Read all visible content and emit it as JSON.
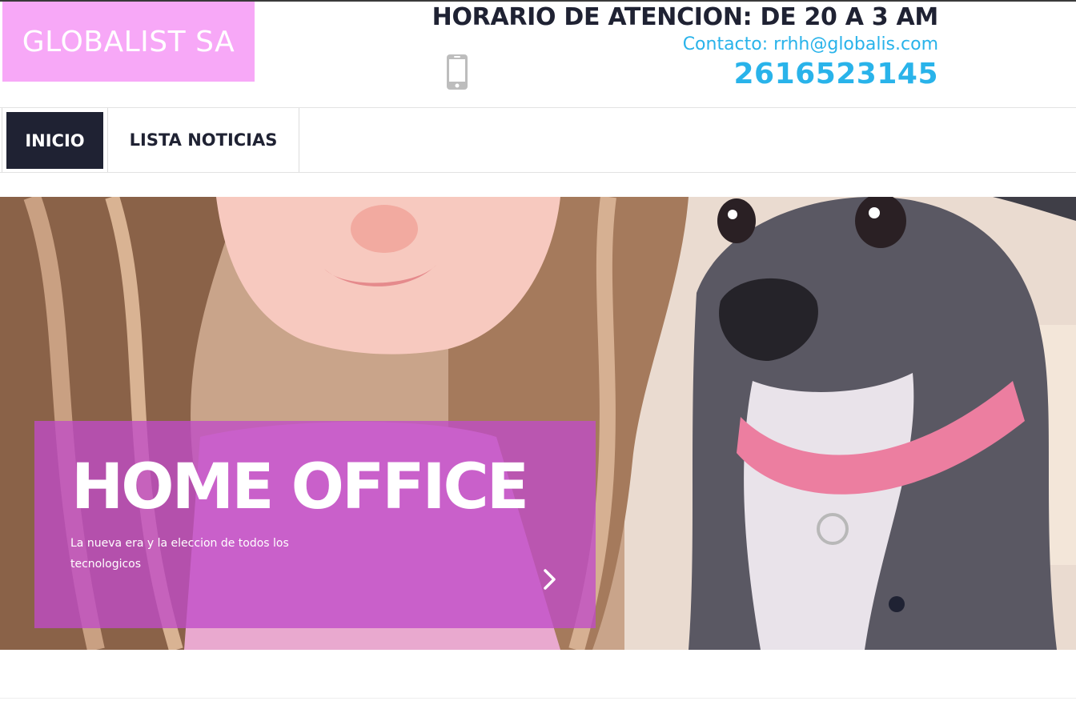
{
  "brand": {
    "name": "GLOBALIST SA",
    "bg_color": "#f7a8f7"
  },
  "header": {
    "hours": "HORARIO DE ATENCION: DE 20 A 3 AM",
    "contact": "Contacto: rrhh@globalis.com",
    "phone": "2616523145",
    "phone_icon": "mobile-phone-icon",
    "accent_color": "#29b3ea",
    "dark_color": "#1f2233"
  },
  "nav": {
    "items": [
      {
        "label": "INICIO",
        "active": true
      },
      {
        "label": "LISTA NOTICIAS",
        "active": false
      }
    ]
  },
  "hero": {
    "title": "HOME OFFICE",
    "text": "La nueva era y la eleccion de todos los tecnologicos",
    "next_icon": "chevron-right-icon",
    "overlay_color": "#c04cc8",
    "slides": 1,
    "active_slide": 1
  }
}
